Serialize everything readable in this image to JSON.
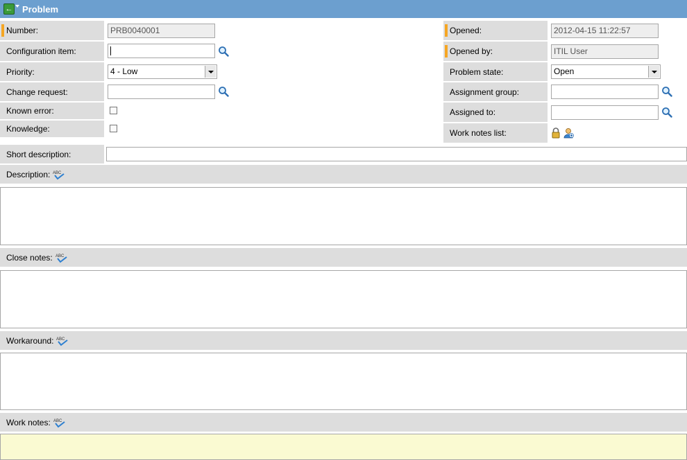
{
  "header": {
    "title": "Problem"
  },
  "left": {
    "number": {
      "label": "Number:",
      "value": "PRB0040001"
    },
    "config_item": {
      "label": "Configuration item:",
      "value": ""
    },
    "priority": {
      "label": "Priority:",
      "value": "4 - Low"
    },
    "change_request": {
      "label": "Change request:",
      "value": ""
    },
    "known_error": {
      "label": "Known error:",
      "checked": false
    },
    "knowledge": {
      "label": "Knowledge:",
      "checked": false
    }
  },
  "right": {
    "opened": {
      "label": "Opened:",
      "value": "2012-04-15 11:22:57"
    },
    "opened_by": {
      "label": "Opened by:",
      "value": "ITIL User"
    },
    "problem_state": {
      "label": "Problem state:",
      "value": "Open"
    },
    "assignment_group": {
      "label": "Assignment group:",
      "value": ""
    },
    "assigned_to": {
      "label": "Assigned to:",
      "value": ""
    },
    "work_notes_list": {
      "label": "Work notes list:"
    }
  },
  "short_description": {
    "label": "Short description:",
    "value": ""
  },
  "sections": {
    "description": "Description:",
    "close_notes": "Close notes:",
    "workaround": "Workaround:",
    "work_notes": "Work notes:"
  },
  "colors": {
    "header": "#6c9fcf",
    "mandatory": "#f5a623",
    "label_bg": "#dddddd",
    "notes_bg": "#fafad2"
  },
  "icons": [
    "back-arrow-icon",
    "menu-arrow-icon",
    "search-icon",
    "lock-icon",
    "add-user-icon",
    "spell-check-icon"
  ]
}
